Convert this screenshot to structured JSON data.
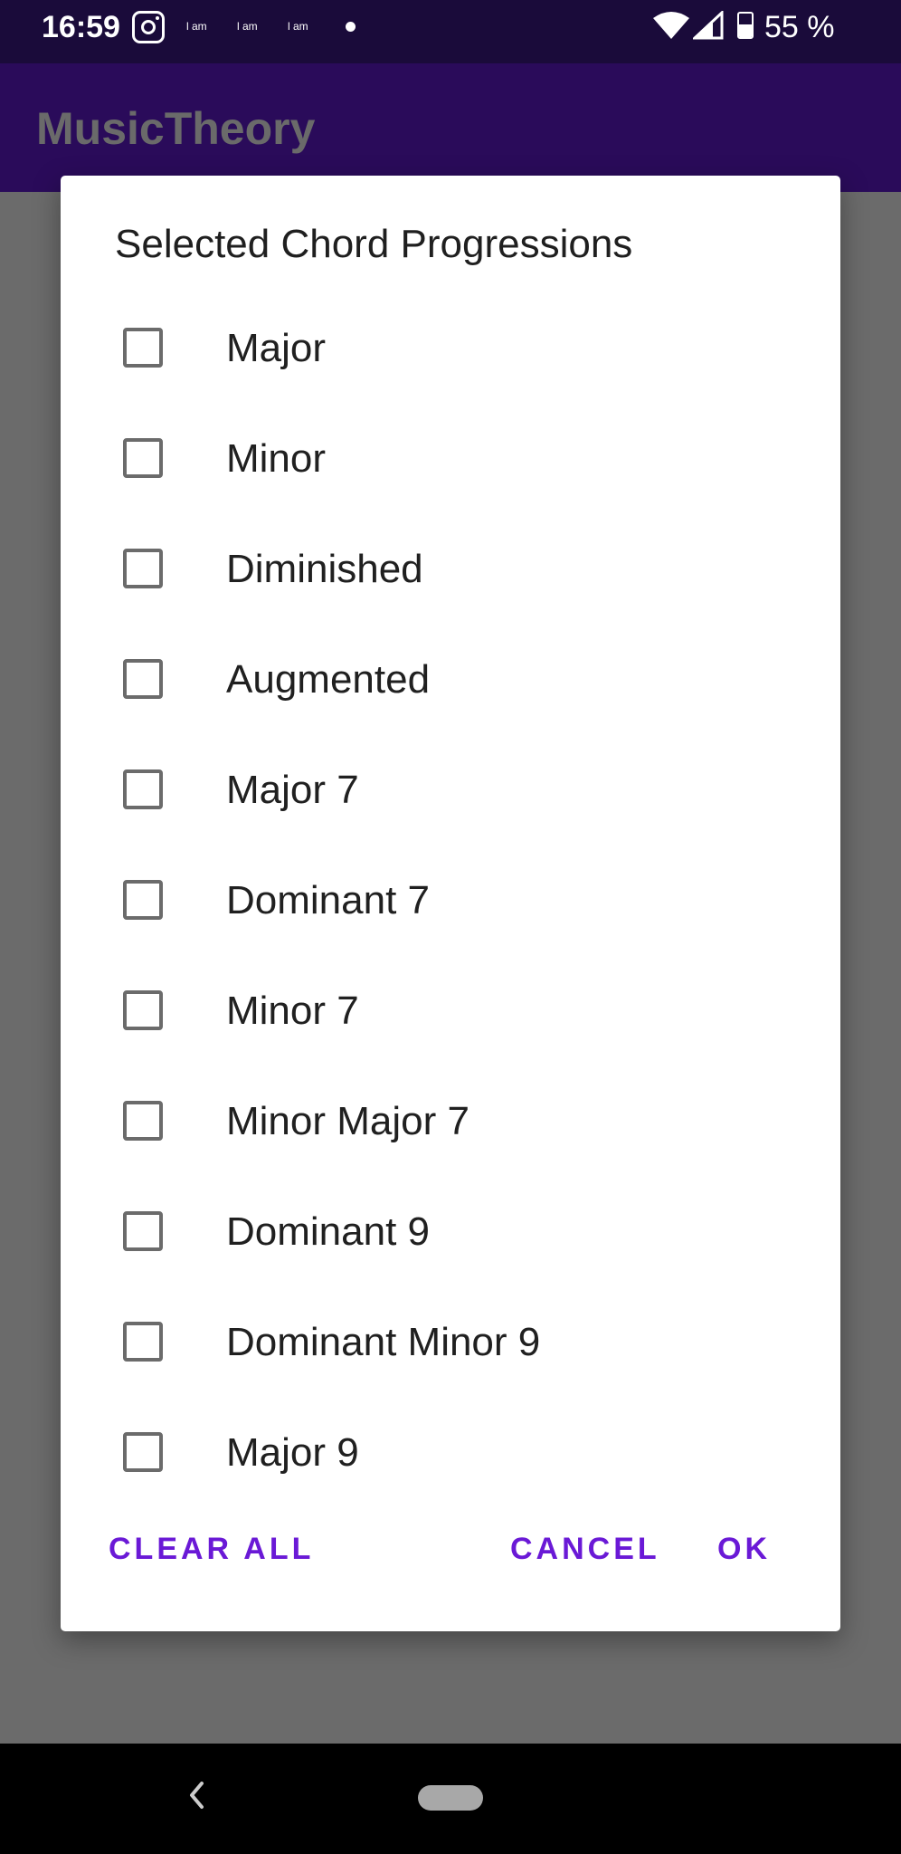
{
  "status_bar": {
    "time": "16:59",
    "notif_small_1": "l am",
    "notif_small_2": "l am",
    "notif_small_3": "l am",
    "battery_percent": "55 %",
    "battery_level": 0.55,
    "icons": [
      "instagram-icon",
      "dot-icon",
      "wifi-icon",
      "signal-icon",
      "battery-icon"
    ]
  },
  "app_bar": {
    "title": "MusicTheory",
    "colors": {
      "background": "#2a0b5a",
      "status": "#1a0b3a"
    }
  },
  "dialog": {
    "title": "Selected Chord Progressions",
    "options": [
      {
        "label": "Major",
        "checked": false
      },
      {
        "label": "Minor",
        "checked": false
      },
      {
        "label": "Diminished",
        "checked": false
      },
      {
        "label": "Augmented",
        "checked": false
      },
      {
        "label": "Major 7",
        "checked": false
      },
      {
        "label": "Dominant 7",
        "checked": false
      },
      {
        "label": "Minor 7",
        "checked": false
      },
      {
        "label": "Minor Major 7",
        "checked": false
      },
      {
        "label": "Dominant 9",
        "checked": false
      },
      {
        "label": "Dominant Minor 9",
        "checked": false
      },
      {
        "label": "Major 9",
        "checked": false
      }
    ],
    "buttons": {
      "clear_all": "CLEAR ALL",
      "cancel": "CANCEL",
      "ok": "OK"
    },
    "accent_color": "#6a19d6"
  },
  "nav_bar": {
    "icons": [
      "back-icon",
      "home-pill"
    ]
  }
}
